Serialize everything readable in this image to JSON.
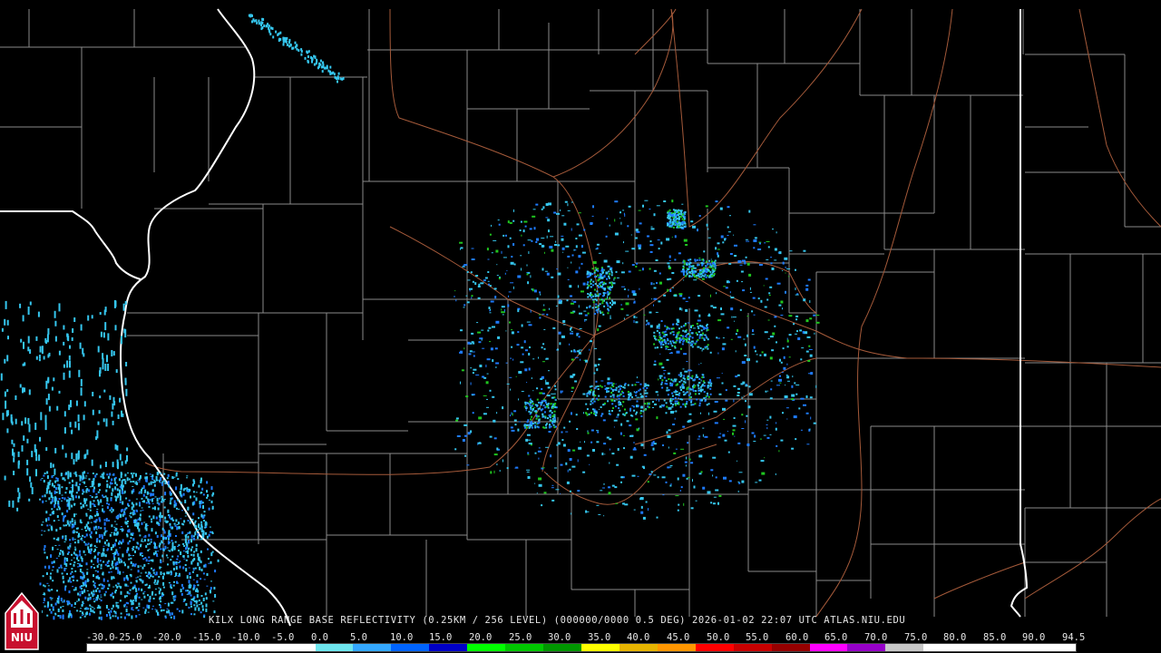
{
  "product": {
    "title": "KILX LONG RANGE BASE REFLECTIVITY (0.25KM / 256 LEVEL) (000000/0000 0.5 DEG) 2026-01-02 22:07 UTC  ATLAS.NIU.EDU"
  },
  "logo": {
    "text": "NIU"
  },
  "scale": {
    "labels": [
      "-30.0",
      "-25.0",
      "-20.0",
      "-15.0",
      "-10.0",
      "-5.0",
      "0.0",
      "5.0",
      "10.0",
      "15.0",
      "20.0",
      "25.0",
      "30.0",
      "35.0",
      "40.0",
      "45.0",
      "50.0",
      "55.0",
      "60.0",
      "65.0",
      "70.0",
      "75.0",
      "80.0",
      "85.0",
      "90.0",
      "94.5"
    ],
    "colors": [
      "#ffffff",
      "#ffffff",
      "#ffffff",
      "#ffffff",
      "#ffffff",
      "#ffffff",
      "#6ee6ee",
      "#34a8ff",
      "#0064ff",
      "#0000c8",
      "#00ff00",
      "#00c800",
      "#009600",
      "#ffff00",
      "#e6b400",
      "#ff9600",
      "#ff0000",
      "#c80000",
      "#960000",
      "#ff00ff",
      "#9600c8",
      "#c8c8c8",
      "#ffffff",
      "#ffffff",
      "#ffffff",
      "#ffffff"
    ]
  },
  "map_colors": {
    "background": "#000000",
    "county_lines": "#8a8a8a",
    "state_lines": "#ffffff",
    "highways": "#a55a3a",
    "echo_light": "#35c6ee",
    "echo_mid": "#1e7bff",
    "echo_strong": "#1fc51f"
  }
}
